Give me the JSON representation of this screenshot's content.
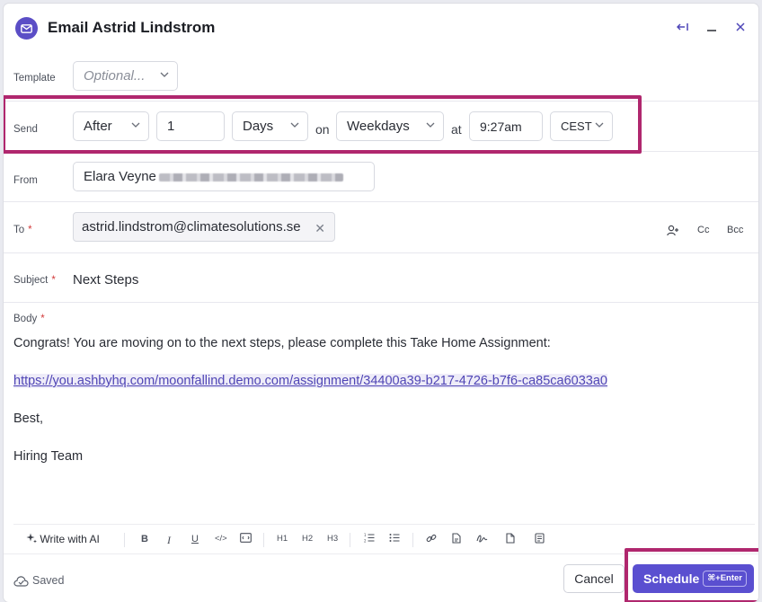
{
  "header": {
    "title": "Email Astrid Lindstrom"
  },
  "template": {
    "label": "Template",
    "placeholder": "Optional..."
  },
  "send": {
    "label": "Send",
    "timing": "After",
    "amount": "1",
    "unit": "Days",
    "on_word": "on",
    "day_type": "Weekdays",
    "at_word": "at",
    "time": "9:27am",
    "timezone": "CEST"
  },
  "from": {
    "label": "From",
    "name": "Elara Veyne"
  },
  "to": {
    "label": "To",
    "required_mark": "*",
    "recipient": "astrid.lindstrom@climatesolutions.se",
    "cc_label": "Cc",
    "bcc_label": "Bcc"
  },
  "subject": {
    "label": "Subject",
    "required_mark": "*",
    "value": "Next Steps"
  },
  "body": {
    "label": "Body",
    "required_mark": "*",
    "line1": "Congrats! You are moving on to the next steps, please complete this Take Home Assignment:",
    "link": "https://you.ashbyhq.com/moonfallind.demo.com/assignment/34400a39-b217-4726-b7f6-ca85ca6033a0",
    "line3": "Best,",
    "line4": "Hiring Team"
  },
  "toolbar": {
    "ai_label": "Write with AI",
    "bold": "B",
    "italic": "I",
    "underline": "U",
    "code": "</>",
    "h1": "H1",
    "h2": "H2",
    "h3": "H3"
  },
  "footer": {
    "saved_label": "Saved",
    "cancel_label": "Cancel",
    "schedule_label": "Schedule",
    "shortcut": "⌘+Enter"
  },
  "colors": {
    "accent": "#5a4fd0",
    "highlight": "#b0276e",
    "link": "#4f45b5"
  }
}
